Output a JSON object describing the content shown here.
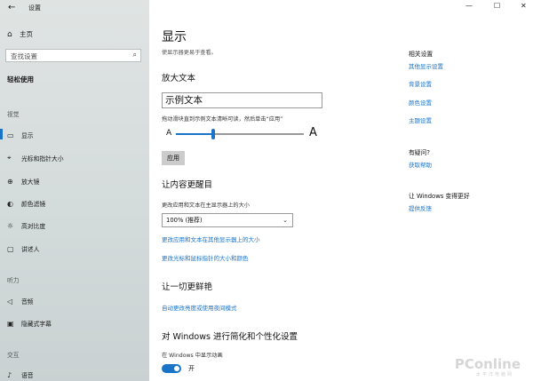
{
  "app": {
    "title": "设置"
  },
  "window_controls": [
    "—",
    "☐",
    "✕"
  ],
  "sidebar": {
    "home": "主页",
    "search_placeholder": "查找设置",
    "category": "轻松使用",
    "groups": [
      {
        "label": "视觉"
      },
      {
        "label": "听力"
      },
      {
        "label": "交互"
      }
    ],
    "items": [
      {
        "label": "显示",
        "icon": "display-icon"
      },
      {
        "label": "光标和指针大小",
        "icon": "cursor-icon"
      },
      {
        "label": "放大镜",
        "icon": "magnifier-icon"
      },
      {
        "label": "颜色滤镜",
        "icon": "color-filter-icon"
      },
      {
        "label": "高对比度",
        "icon": "contrast-icon"
      },
      {
        "label": "讲述人",
        "icon": "narrator-icon"
      },
      {
        "label": "音频",
        "icon": "audio-icon"
      },
      {
        "label": "隐藏式字幕",
        "icon": "captions-icon"
      },
      {
        "label": "语音",
        "icon": "speech-icon"
      }
    ]
  },
  "main": {
    "title": "显示",
    "subtitle": "使显示器更易于查看。",
    "text_size": {
      "heading": "放大文本",
      "sample": "示例文本",
      "hint": "拖动滑块直到示例文本清晰可读，然后单击“应用”",
      "small_a": "A",
      "large_a": "A",
      "slider_fraction": 0.29,
      "apply": "应用"
    },
    "bigger": {
      "heading": "让内容更醒目",
      "label": "更改应用和文本在主显示器上的大小",
      "value": "100% (推荐)",
      "link1": "更改应用和文本在其他显示器上的大小",
      "link2": "更改光标和鼠标指针的大小和颜色"
    },
    "brighter": {
      "heading": "让一切更鲜艳",
      "link": "自动更改亮度或使用夜间模式"
    },
    "simplify": {
      "heading": "对 Windows 进行简化和个性化设置",
      "label": "在 Windows 中显示动画",
      "toggle_state": "开",
      "toggle_on": true
    }
  },
  "right": {
    "related_heading": "相关设置",
    "related_links": [
      "其他显示设置",
      "背景设置",
      "颜色设置",
      "主题设置"
    ],
    "question_heading": "有疑问?",
    "question_link": "获取帮助",
    "improve_heading": "让 Windows 变得更好",
    "improve_link": "提供反馈"
  },
  "watermark": {
    "brand": "PConline",
    "sub": "太平洋电脑网"
  },
  "colors": {
    "accent": "#1a73c7",
    "sidebar_bg": "#d8dede"
  }
}
